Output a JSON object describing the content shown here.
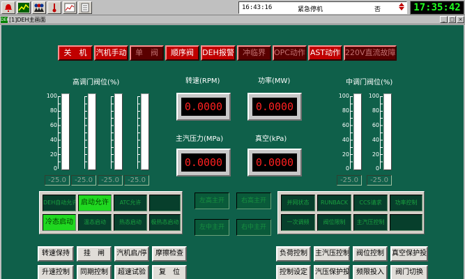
{
  "toolbar": {
    "icons": [
      "alarm-bell-icon",
      "trend-chart-icon",
      "users-icon",
      "thermometer-icon",
      "graph-icon",
      "notepad-icon"
    ]
  },
  "status": {
    "time": "16:43:16",
    "event": "紧急停机",
    "value": "否"
  },
  "clock": "17:35:42",
  "window": {
    "icon_text": "DEH",
    "title": "[1]DEH主画面",
    "min": "_",
    "max": "□",
    "close": "×"
  },
  "alarms": [
    {
      "label": "关　机",
      "state": "on"
    },
    {
      "label": "汽机手动",
      "state": "on"
    },
    {
      "label": "单　阀",
      "state": "dim"
    },
    {
      "label": "顺序阀",
      "state": "on"
    },
    {
      "label": "DEH报警",
      "state": "on"
    },
    {
      "label": "冲临界",
      "state": "dim"
    },
    {
      "label": "OPC动作",
      "state": "dim"
    },
    {
      "label": "AST动作",
      "state": "on"
    },
    {
      "label": "220V直流故障",
      "state": "dim"
    }
  ],
  "hv_section": {
    "title": "高调门阀位(%)",
    "scale": [
      "100",
      "80",
      "60",
      "40",
      "20",
      "0"
    ],
    "gauges": [
      {
        "value": "-25.0",
        "level": 0
      },
      {
        "value": "-25.0",
        "level": 0
      },
      {
        "value": "-25.0",
        "level": 0
      },
      {
        "value": "-25.0",
        "level": 0
      }
    ]
  },
  "mv_section": {
    "title": "中调门阀位(%)",
    "scale": [
      "100",
      "80",
      "60",
      "40",
      "20",
      "0"
    ],
    "gauges": [
      {
        "value": "-25.0",
        "level": 0
      },
      {
        "value": "-25.0",
        "level": 0
      }
    ]
  },
  "readouts": {
    "speed": {
      "label": "转速(RPM)",
      "value": "0.0000"
    },
    "power": {
      "label": "功率(MW)",
      "value": "0.0000"
    },
    "steam_pressure": {
      "label": "主汽压力(MPa)",
      "value": "0.0000"
    },
    "vacuum": {
      "label": "真空(kPa)",
      "value": "0.0000"
    }
  },
  "left_panel": [
    {
      "label": "DEH自动允许",
      "lit": false
    },
    {
      "label": "启动允许",
      "lit": true
    },
    {
      "label": "ATC允许",
      "lit": false
    },
    {
      "label": "",
      "lit": false
    },
    {
      "label": "冷态启动",
      "lit": true
    },
    {
      "label": "温态启动",
      "lit": false
    },
    {
      "label": "热态启动",
      "lit": false
    },
    {
      "label": "极热态启动",
      "lit": false
    }
  ],
  "center_cells": [
    "左高主开",
    "右高主开",
    "左中主开",
    "右中主开"
  ],
  "right_panel": [
    {
      "label": "并网状态",
      "lit": false
    },
    {
      "label": "RUNBACK",
      "lit": false
    },
    {
      "label": "CCS请求",
      "lit": false
    },
    {
      "label": "功率控制",
      "lit": false
    },
    {
      "label": "一次调频",
      "lit": false
    },
    {
      "label": "阀位限制",
      "lit": false
    },
    {
      "label": "主汽压控制",
      "lit": false
    },
    {
      "label": "",
      "lit": false
    }
  ],
  "buttons_row1": [
    "转速保持",
    "挂　闸",
    "汽机启/停",
    "摩擦检查",
    "负荷控制",
    "主汽压控制",
    "阀位控制",
    "真空保护投入"
  ],
  "buttons_row2": [
    "升速控制",
    "同期控制",
    "超速试验",
    "复　位",
    "控制设定",
    "汽压保护投入",
    "频限投入",
    "阀门切换"
  ]
}
